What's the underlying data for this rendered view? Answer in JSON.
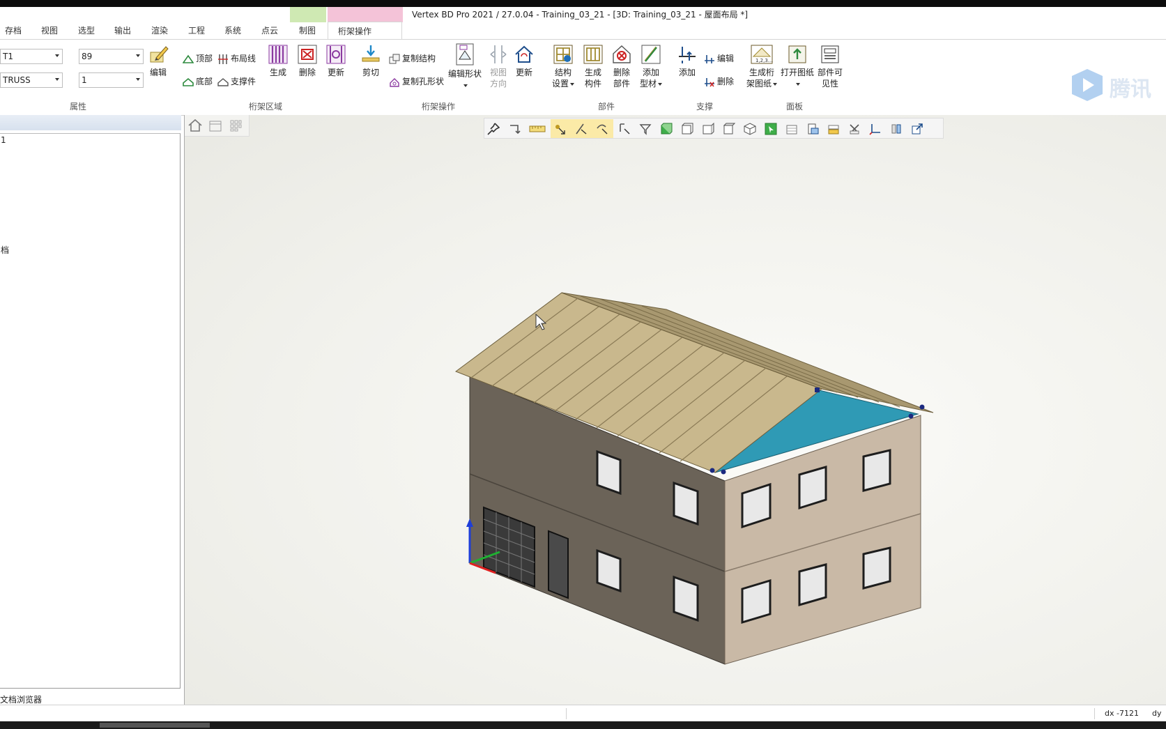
{
  "window": {
    "title": "Vertex BD Pro 2021 / 27.0.04 - Training_03_21 - [3D: Training_03_21 - 屋面布局 *]"
  },
  "tabs": [
    "存档",
    "视图",
    "选型",
    "输出",
    "渲染",
    "工程",
    "系统",
    "点云",
    "制图",
    "桁架操作"
  ],
  "active_tab": "桁架操作",
  "ribbon": {
    "properties": {
      "combo_name": "T1",
      "combo_type": "TRUSS",
      "combo_size": "89",
      "combo_qty": "1",
      "edit_label": "编辑",
      "group_label": "属性"
    },
    "truss_area": {
      "top_label": "顶部",
      "bottom_label": "底部",
      "layout_label": "布局线",
      "support_label": "支撑件",
      "generate_label": "生成",
      "delete_label": "删除",
      "update_label": "更新",
      "group_label": "桁架区域"
    },
    "truss_ops": {
      "cut_label": "剪切",
      "copy_struct_label": "复制结构",
      "copy_hole_label": "复制孔形状",
      "edit_shape_label": "编辑形状",
      "view_dir_label_1": "视图",
      "view_dir_label_2": "方向",
      "update_label": "更新",
      "group_label": "桁架操作"
    },
    "parts": {
      "struct_settings_1": "结构",
      "struct_settings_2": "设置",
      "gen_parts_1": "生成",
      "gen_parts_2": "构件",
      "del_parts_1": "删除",
      "del_parts_2": "部件",
      "add_profile_1": "添加",
      "add_profile_2": "型材",
      "group_label": "部件"
    },
    "bracing": {
      "add_label": "添加",
      "edit_label": "编辑",
      "delete_label": "删除",
      "group_label": "支撑"
    },
    "panel": {
      "gen_truss_1": "生成桁",
      "gen_truss_2": "架图纸",
      "gen_truss_icon_text": "1,2,3...",
      "open_drawing_label": "打开图纸",
      "part_vis_1": "部件可",
      "part_vis_2": "见性",
      "group_label": "面板"
    }
  },
  "left_panel": {
    "tree_items": [
      "1",
      "档"
    ],
    "footer_label": "文档浏览器"
  },
  "watermark_text": "腾讯",
  "status": {
    "dx": "dx -7121",
    "dy": "dy -"
  },
  "colors": {
    "roof": "#c9b88d",
    "roof_gable": "#2f9ab5",
    "wall_dark": "#6b6358",
    "wall_light": "#c9b9a6",
    "ctx_green": "#cfe9b3",
    "ctx_pink": "#f4c3d8"
  }
}
